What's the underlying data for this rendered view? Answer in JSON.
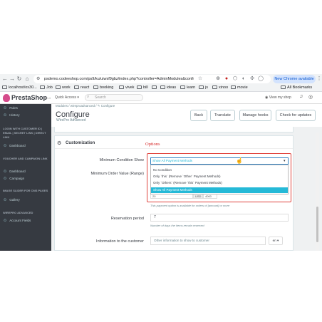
{
  "browser": {
    "url": "psdemo.codeeshop.com/ps9/ku/uiwsf9gbz/index.php?controller=AdminModules&configure=wi...",
    "new_chrome": "New Chrome available",
    "bookmarks": [
      "localhost/ox30...",
      "Job",
      "work",
      "react",
      "booking",
      "vivek",
      "bill",
      "",
      "ideas",
      "learn",
      "js",
      "xinoo",
      "movie"
    ],
    "all_bookmarks": "All Bookmarks"
  },
  "ps_header": {
    "logo": "PrestaShop",
    "version": "8.0.4",
    "quick_access": "Quick Access ▾",
    "search_placeholder": "Search",
    "view_shop": "View my shop"
  },
  "sidebar": {
    "items": [
      {
        "icon": "rules-icon",
        "label": "Rules"
      },
      {
        "icon": "history-icon",
        "label": "History"
      }
    ],
    "section1": "LOGIN WITH CUSTOMER ID | EMAIL | SECRET LINK | DIRECT LINK",
    "section1_items": [
      {
        "label": "Dashboard"
      }
    ],
    "section2": "VOUCHER AND CAMPAIGN LINK",
    "section2_items": [
      {
        "label": "Dashboard"
      },
      {
        "label": "Campaign"
      }
    ],
    "section3": "IMAGE SLIDER FOR CMS PAGES",
    "section3_items": [
      {
        "label": "Gallery"
      }
    ],
    "section4": "WIREPRO ADVANCED",
    "section4_items": [
      {
        "label": "Account Fields"
      }
    ]
  },
  "page": {
    "breadcrumb": "Modules / wireproadvanced / ✎ Configure",
    "title": "Configure",
    "subtitle": "WirePro Advanced",
    "buttons": {
      "back": "Back",
      "translate": "Translate",
      "manage_hooks": "Manage hooks",
      "check_updates": "Check for updates"
    }
  },
  "form": {
    "section_title": "Customization",
    "annotation": "Options",
    "min_condition_label": "Minimum Condition Show",
    "min_order_label": "Minimum Order Value (Range)",
    "selected": "Show All Payment Methods",
    "options": [
      "No Condition",
      "Only `this` (Remove `Other` Payment Methods)",
      "Only `Others` (Remove `this` Payment Methods)",
      "Show All Payment Methods"
    ],
    "range_from": "20",
    "range_currency": "USD",
    "range_to": "4000",
    "range_help": "This payment option is available for orders of [amount] or more",
    "reservation_label": "Reservation period",
    "reservation_value": "7",
    "reservation_help": "Number of days the items remain reserved",
    "info_label": "Information to the customer",
    "info_placeholder": "Other information to show to customer",
    "lang": "en ▾"
  },
  "colors": {
    "accent": "#25b9d7",
    "sidebar": "#363a41",
    "highlight_border": "#e0443e",
    "annotation": "#d62b2b"
  }
}
